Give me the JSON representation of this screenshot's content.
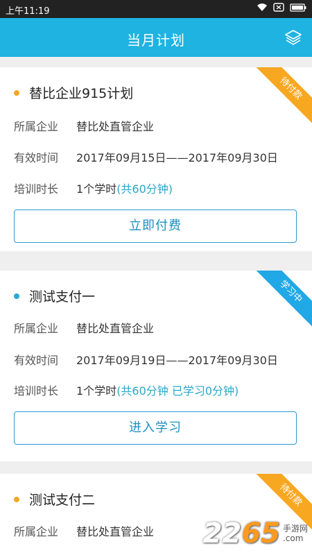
{
  "status_bar": {
    "time": "上午11:19"
  },
  "header": {
    "title": "当月计划",
    "layers_icon": "layers-icon"
  },
  "plans": [
    {
      "title": "替比企业915计划",
      "dot_color": "#f5a623",
      "ribbon": "待付款",
      "ribbon_color": "orange",
      "company_label": "所属企业",
      "company": "替比处直管企业",
      "period_label": "有效时间",
      "period": "2017年09月15日——2017年09月30日",
      "duration_label": "培训时长",
      "duration": "1个学时",
      "duration_detail": "(共60分钟)",
      "button": "立即付费"
    },
    {
      "title": "测试支付一",
      "dot_color": "#29a9d4",
      "ribbon": "学习中",
      "ribbon_color": "blue",
      "company_label": "所属企业",
      "company": "替比处直管企业",
      "period_label": "有效时间",
      "period": "2017年09月19日——2017年09月30日",
      "duration_label": "培训时长",
      "duration": "1个学时",
      "duration_detail": "(共60分钟  已学习0分钟)",
      "button": "进入学习"
    },
    {
      "title": "测试支付二",
      "dot_color": "#f5a623",
      "ribbon": "待付款",
      "ribbon_color": "orange",
      "company_label": "所属企业",
      "company": "替比处直管企业"
    }
  ],
  "watermark": {
    "number_a": "22",
    "number_b": "65",
    "sub_a": "手游网",
    "sub_b": ".com"
  }
}
